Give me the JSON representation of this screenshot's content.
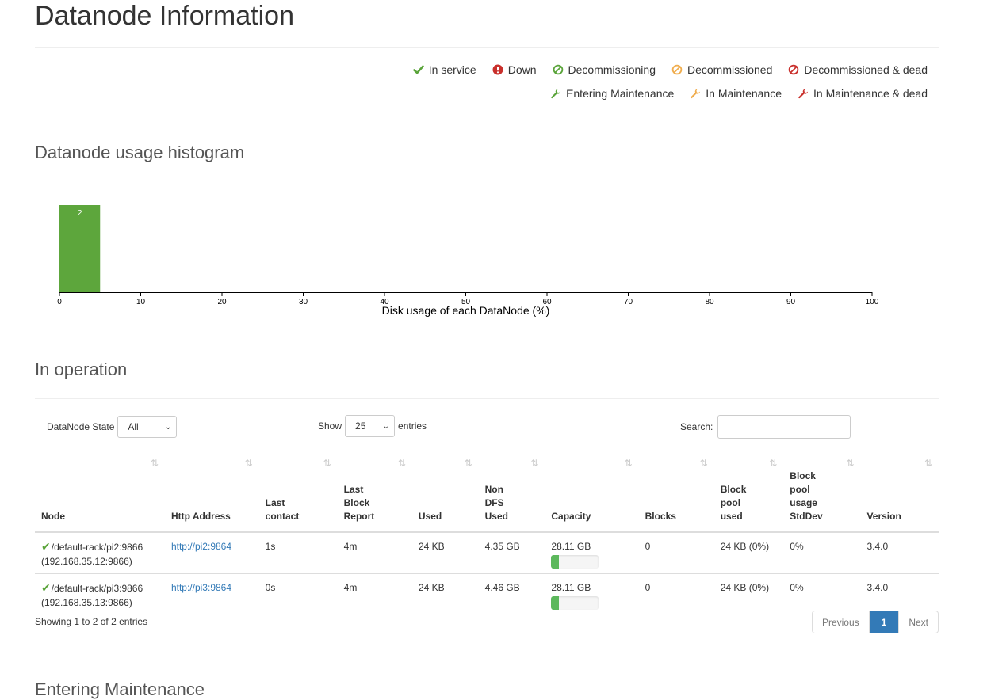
{
  "page": {
    "title": "Datanode Information"
  },
  "legend": {
    "row1": [
      {
        "label": "In service",
        "icon": "check-icon",
        "color": "#5aa43a"
      },
      {
        "label": "Down",
        "icon": "exclamation-circle-icon",
        "color": "#c9302c"
      },
      {
        "label": "Decommissioning",
        "icon": "ban-circle-icon",
        "color": "#5aa43a"
      },
      {
        "label": "Decommissioned",
        "icon": "ban-circle-icon",
        "color": "#f0ad4e"
      },
      {
        "label": "Decommissioned & dead",
        "icon": "ban-circle-icon",
        "color": "#c9302c"
      }
    ],
    "row2": [
      {
        "label": "Entering Maintenance",
        "icon": "wrench-icon",
        "color": "#5aa43a"
      },
      {
        "label": "In Maintenance",
        "icon": "wrench-icon",
        "color": "#f0ad4e"
      },
      {
        "label": "In Maintenance & dead",
        "icon": "wrench-icon",
        "color": "#c9302c"
      }
    ]
  },
  "histogram": {
    "section_title": "Datanode usage histogram"
  },
  "chart_data": {
    "type": "bar",
    "xlabel": "Disk usage of each DataNode (%)",
    "xlim": [
      0,
      100
    ],
    "xticks": [
      0,
      10,
      20,
      30,
      40,
      50,
      60,
      70,
      80,
      90,
      100
    ],
    "bins": [
      {
        "x0": 0,
        "x1": 5,
        "count": 2
      }
    ],
    "bar_color": "#5da63c"
  },
  "operation": {
    "section_title": "In operation",
    "state_label": "DataNode State",
    "state_value": "All",
    "show_label": "Show",
    "show_value": "25",
    "entries_label": "entries",
    "search_label": "Search:",
    "search_value": "",
    "columns": [
      [
        "Node"
      ],
      [
        "Http Address"
      ],
      [
        "Last",
        "contact"
      ],
      [
        "Last",
        "Block",
        "Report"
      ],
      [
        "Used"
      ],
      [
        "Non",
        "DFS",
        "Used"
      ],
      [
        "Capacity"
      ],
      [
        "Blocks"
      ],
      [
        "Block",
        "pool",
        "used"
      ],
      [
        "Block",
        "pool",
        "usage",
        "StdDev"
      ],
      [
        "Version"
      ]
    ],
    "rows": [
      {
        "node": "/default-rack/pi2:9866",
        "node_ip": "(192.168.35.12:9866)",
        "http": "http://pi2:9864",
        "last_contact": "1s",
        "last_block_report": "4m",
        "used": "24 KB",
        "non_dfs_used": "4.35 GB",
        "capacity": "28.11 GB",
        "capacity_used_pct": 16,
        "blocks": "0",
        "block_pool_used": "24 KB (0%)",
        "stddev": "0%",
        "version": "3.4.0"
      },
      {
        "node": "/default-rack/pi3:9866",
        "node_ip": "(192.168.35.13:9866)",
        "http": "http://pi3:9864",
        "last_contact": "0s",
        "last_block_report": "4m",
        "used": "24 KB",
        "non_dfs_used": "4.46 GB",
        "capacity": "28.11 GB",
        "capacity_used_pct": 16,
        "blocks": "0",
        "block_pool_used": "24 KB (0%)",
        "stddev": "0%",
        "version": "3.4.0"
      }
    ],
    "info": "Showing 1 to 2 of 2 entries",
    "pager": {
      "previous": "Previous",
      "current": "1",
      "next": "Next"
    }
  },
  "next_section": {
    "title": "Entering Maintenance"
  }
}
